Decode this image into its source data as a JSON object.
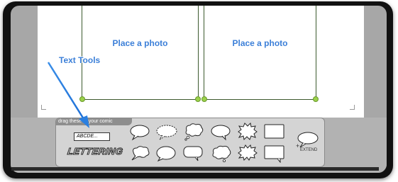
{
  "panels": [
    {
      "label": "Place a photo"
    },
    {
      "label": "Place a photo"
    }
  ],
  "annotation": {
    "label": "Text Tools",
    "color": "#3b7fd8"
  },
  "toolbox": {
    "tab_label": "drag these to your comic",
    "text_box_label": "ABCDE...",
    "lettering_label": "LETTERING",
    "extend_label": "EXTEND",
    "plus_label": "+"
  },
  "icons": [
    "speech-bubble-icon",
    "thought-bubble-icon",
    "shout-bubble-icon",
    "caption-box-icon",
    "extend-bubble-icon"
  ]
}
